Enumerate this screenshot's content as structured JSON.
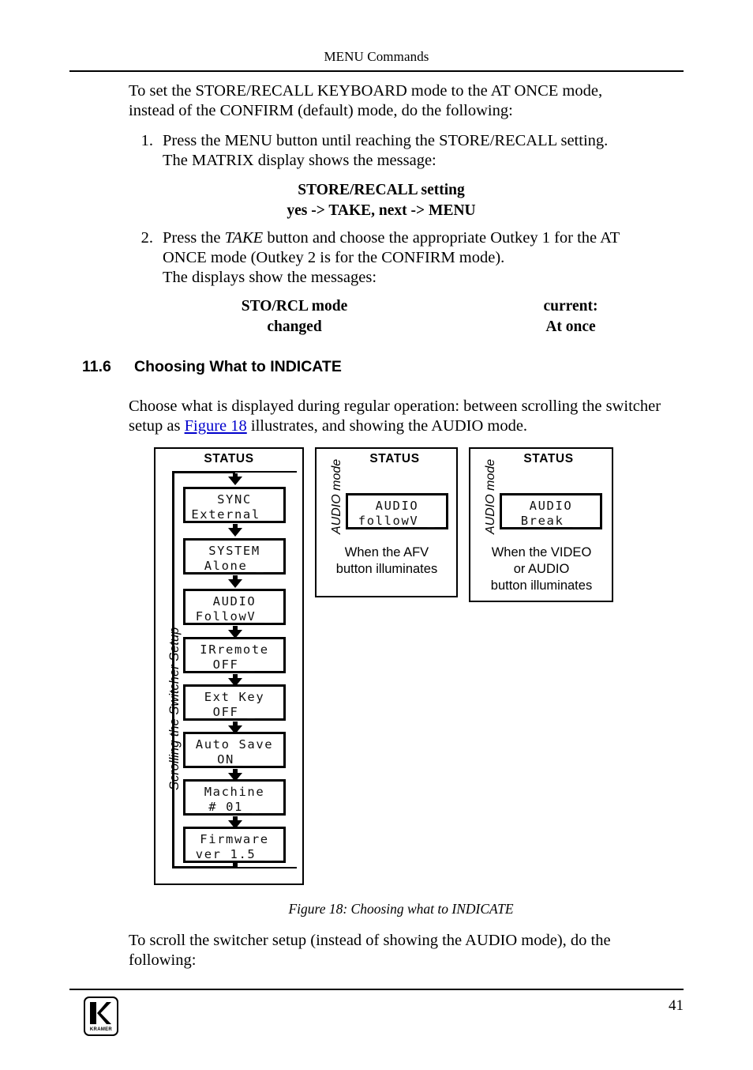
{
  "header": {
    "title": "MENU Commands"
  },
  "intro": {
    "line1": "To set the STORE/RECALL KEYBOARD mode to the AT ONCE mode,",
    "line2": "instead of the CONFIRM (default) mode, do the following:"
  },
  "steps": [
    {
      "number": "1.",
      "line1": "Press the MENU button until reaching the STORE/RECALL setting.",
      "line2": "The MATRIX display shows the message:"
    },
    {
      "number": "2.",
      "pre": "Press the ",
      "emph": "TAKE",
      "post": " button and choose the appropriate Outkey 1 for the AT",
      "line2": "ONCE mode (Outkey 2 is for the CONFIRM mode).",
      "line3": "The displays show the messages:"
    }
  ],
  "display_message_1": {
    "line1": "STORE/RECALL setting",
    "line2": "yes -> TAKE, next -> MENU"
  },
  "display_message_2": {
    "left_line1": "STO/RCL mode",
    "left_line2": "changed",
    "right_line1": "current:",
    "right_line2": "At once"
  },
  "section": {
    "number": "11.6",
    "title": "Choosing What to INDICATE",
    "body_pre": "Choose what is displayed during regular operation: between scrolling the switcher setup as ",
    "body_link": "Figure 18",
    "body_post": " illustrates, and showing the AUDIO mode."
  },
  "figure": {
    "caption": "Figure 18: Choosing what to INDICATE",
    "left_panel": {
      "status_label": "STATUS",
      "side_label": "Scrolling the Switcher Setup",
      "screens": [
        {
          "line1": "SYNC",
          "line2": "External _"
        },
        {
          "line1": "SYSTEM",
          "line2": "Alone _"
        },
        {
          "line1": "AUDIO",
          "line2": "FollowV _"
        },
        {
          "line1": "IRremote",
          "line2": "OFF _"
        },
        {
          "line1": "Ext Key",
          "line2": "OFF _"
        },
        {
          "line1": "Auto Save",
          "line2": "ON _"
        },
        {
          "line1": "Machine",
          "line2": "# 01 _"
        },
        {
          "line1": "Firmware",
          "line2": "ver 1.5 _"
        }
      ]
    },
    "mid_panel": {
      "status_label": "STATUS",
      "side_label": "AUDIO mode",
      "screen": {
        "line1": "AUDIO",
        "line2": "followV _"
      },
      "caption_line1": "When the AFV",
      "caption_line2": "button illuminates"
    },
    "right_panel": {
      "status_label": "STATUS",
      "side_label": "AUDIO mode",
      "screen": {
        "line1": "AUDIO",
        "line2": "Break _"
      },
      "caption_line1": "When the VIDEO",
      "caption_line2": "or AUDIO",
      "caption_line3": "button illuminates"
    }
  },
  "closing": {
    "line1": "To scroll the switcher setup (instead of showing the AUDIO mode), do the",
    "line2": "following:"
  },
  "footer": {
    "logo_word": "KRAMER",
    "page_number": "41"
  },
  "colors": {
    "link": "#0000cc",
    "ink": "#000000",
    "paper": "#ffffff"
  }
}
